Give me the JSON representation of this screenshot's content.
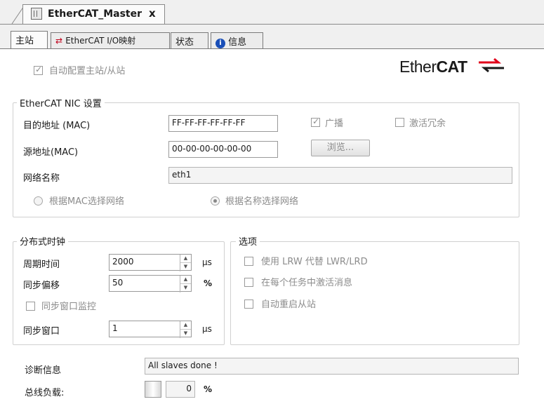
{
  "document_tab": {
    "title": "EtherCAT_Master",
    "close_glyph": "x",
    "icon": "device-icon"
  },
  "tabs": [
    {
      "label": "主站",
      "active": true
    },
    {
      "label": "EtherCAT I/O映射",
      "icon": "io-map-icon"
    },
    {
      "label": "状态"
    },
    {
      "label": "信息",
      "icon": "info-icon"
    }
  ],
  "auto_config": {
    "label": "自动配置主站/从站",
    "checked": true
  },
  "logo": {
    "text_normal": "Ether",
    "text_bold": "CAT"
  },
  "nic": {
    "legend": "EtherCAT NIC 设置",
    "dest_label": "目的地址 (MAC)",
    "dest_value": "FF-FF-FF-FF-FF-FF",
    "broadcast_label": "广播",
    "broadcast_checked": true,
    "redundancy_label": "激活冗余",
    "redundancy_checked": false,
    "source_label": "源地址(MAC)",
    "source_value": "00-00-00-00-00-00",
    "browse_label": "浏览...",
    "network_name_label": "网络名称",
    "network_name_value": "eth1",
    "select_by_mac_label": "根据MAC选择网络",
    "select_by_name_label": "根据名称选择网络"
  },
  "dc": {
    "legend": "分布式时钟",
    "cycle_label": "周期时间",
    "cycle_value": "2000",
    "cycle_unit": "µs",
    "sync_offset_label": "同步偏移",
    "sync_offset_value": "50",
    "sync_offset_unit": "%",
    "sync_window_monitor_label": "同步窗口监控",
    "sync_window_label": "同步窗口",
    "sync_window_value": "1",
    "sync_window_unit": "µs"
  },
  "options": {
    "legend": "选项",
    "use_lrw_label": "使用 LRW 代替 LWR/LRD",
    "activate_msg_label": "在每个任务中激活消息",
    "auto_restart_label": "自动重启从站"
  },
  "diagnostics": {
    "label": "诊断信息",
    "value": "All slaves done !"
  },
  "bus_load": {
    "label": "总线负载:",
    "value": "0",
    "unit": "%"
  },
  "colors": {
    "panel_bg": "#ffffff",
    "chrome_bg": "#f0f0f0",
    "logo_red": "#e1001a"
  }
}
